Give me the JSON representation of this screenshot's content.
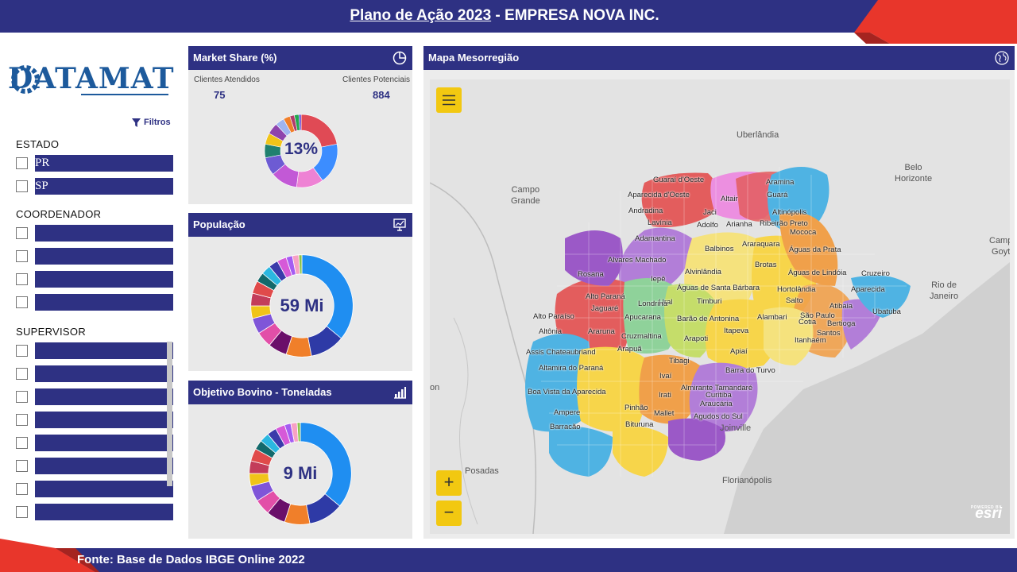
{
  "header": {
    "title_underlined": "Plano de Ação 2023",
    "title_rest": " - EMPRESA NOVA INC."
  },
  "footer": {
    "source": "Fonte: Base de Dados IBGE Online 2022"
  },
  "logo": {
    "text": "DATAMAT"
  },
  "filters": {
    "button_label": "Filtros",
    "estado": {
      "label": "ESTADO",
      "options": [
        "PR",
        "SP"
      ]
    },
    "coordenador": {
      "label": "COORDENADOR",
      "options": [
        "",
        "",
        "",
        ""
      ]
    },
    "supervisor": {
      "label": "SUPERVISOR",
      "options": [
        "",
        "",
        "",
        "",
        "",
        "",
        "",
        ""
      ]
    }
  },
  "market_share": {
    "title": "Market Share (%)",
    "clientes_atendidos_label": "Clientes Atendidos",
    "clientes_atendidos_value": "75",
    "clientes_potenciais_label": "Clientes Potenciais",
    "clientes_potenciais_value": "884",
    "center_value": "13%",
    "chart_data": {
      "type": "pie",
      "values": [
        22,
        18,
        12,
        12,
        8,
        6,
        5,
        5,
        4,
        3,
        2,
        2,
        1
      ],
      "colors": [
        "#e04a55",
        "#3c8dff",
        "#ee82d4",
        "#c259d6",
        "#6d5bd3",
        "#20806f",
        "#f0c419",
        "#8e44ad",
        "#9fb4f0",
        "#f07f2a",
        "#b23a6b",
        "#22a84f",
        "#5b3fd6"
      ]
    }
  },
  "populacao": {
    "title": "População",
    "center_value": "59 Mi",
    "chart_data": {
      "type": "pie",
      "values": [
        36,
        11,
        8,
        6,
        5,
        5,
        4,
        4,
        4,
        3,
        3,
        3,
        3,
        2,
        2,
        1
      ],
      "colors": [
        "#1f8ef1",
        "#2e3aa6",
        "#f07f2a",
        "#6a0f6a",
        "#e24fa8",
        "#7f55d8",
        "#f0c419",
        "#c33c5a",
        "#e04a4a",
        "#13696b",
        "#2bb7e0",
        "#3a3aaa",
        "#d65ad8",
        "#a45cf2",
        "#f7a1c4",
        "#8bc34a"
      ]
    }
  },
  "bovino": {
    "title": "Objetivo Bovino - Toneladas",
    "center_value": "9 Mi",
    "chart_data": {
      "type": "pie",
      "values": [
        36,
        11,
        8,
        6,
        5,
        5,
        4,
        4,
        4,
        3,
        3,
        3,
        3,
        2,
        2,
        1
      ],
      "colors": [
        "#1f8ef1",
        "#2e3aa6",
        "#f07f2a",
        "#6a0f6a",
        "#e24fa8",
        "#7f55d8",
        "#f0c419",
        "#c33c5a",
        "#e04a4a",
        "#13696b",
        "#2bb7e0",
        "#3a3aaa",
        "#d65ad8",
        "#a45cf2",
        "#f7a1c4",
        "#8bc34a"
      ]
    }
  },
  "map": {
    "title": "Mapa Mesorregião",
    "zoom_in": "+",
    "zoom_out": "−",
    "menu_icon": "hamburger-icon",
    "globe_icon": "globe-icon",
    "esri_label": "esri",
    "esri_powered": "POWERED BY",
    "region_colors": [
      "#4fb3e3",
      "#e35d5d",
      "#ec8fe0",
      "#9b59c7",
      "#c5dd6a",
      "#f7d54a",
      "#f0a04a",
      "#8fd29a",
      "#b27ed8",
      "#f5e27d"
    ],
    "places": {
      "uberlandia": "Uberlândia",
      "belo_horizonte": "Belo\nHorizonte",
      "campo_grande": "Campo\nGrande",
      "rio_de_janeiro": "Rio de\nJaneiro",
      "camp": "Camp\nGoyt",
      "posadas": "Posadas",
      "florianopolis": "Florianópolis",
      "joinville": "Joinville",
      "on": "on"
    },
    "municipalities": {
      "m1": "Guaraí d'Oeste",
      "m2": "Aparecida d'Oeste",
      "m3": "Andradina",
      "m4": "Lavínia",
      "m5": "Adamantina",
      "m6": "Altair",
      "m7": "Jaci",
      "m8": "Adolfo",
      "m9": "Aramina",
      "m10": "Guará",
      "m11": "Altinópolis",
      "m12": "Ribeirão Preto",
      "m13": "Arianha",
      "m14": "Mococa",
      "m15": "Balbinos",
      "m16": "Araraquara",
      "m17": "Águas da Prata",
      "m18": "Alvares Machado",
      "m19": "Brotas",
      "m20": "Águas de Lindóia",
      "m21": "Cruzeiro",
      "m22": "Rosana",
      "m23": "Iepê",
      "m24": "Alvinlândia",
      "m25": "Águas de Santa Bárbara",
      "m26": "Hortolândia",
      "m27": "Aparecida",
      "m28": "Alto Paraná",
      "m29": "Ural",
      "m30": "Timburi",
      "m31": "Salto",
      "m32": "Jaguaré",
      "m33": "Londrina",
      "m34": "Atibaia",
      "m35": "Alto Paraíso",
      "m36": "Apucarana",
      "m37": "Barão de Antonina",
      "m38": "Alambari",
      "m39": "São Paulo",
      "m40": "Bertioga",
      "m41": "Altônia",
      "m42": "Araruna",
      "m43": "Itapeva",
      "m44": "Cotia",
      "m45": "Santos",
      "m46": "Ubatuba",
      "m47": "Cruzmaltina",
      "m48": "Arapoti",
      "m49": "Itanhaém",
      "m50": "Assis Chateaubriand",
      "m51": "Arapuã",
      "m52": "Apiaí",
      "m53": "Altamira do Paraná",
      "m54": "Tibagi",
      "m55": "Barra do Turvo",
      "m56": "Ivaí",
      "m57": "Boa Vista da Aparecida",
      "m58": "Almirante Tamandaré",
      "m59": "Curitiba",
      "m60": "Irati",
      "m61": "Araucária",
      "m62": "Ampere",
      "m63": "Pinhão",
      "m64": "Mallet",
      "m65": "Agudos do Sul",
      "m66": "Barracão",
      "m67": "Bituruna"
    }
  }
}
